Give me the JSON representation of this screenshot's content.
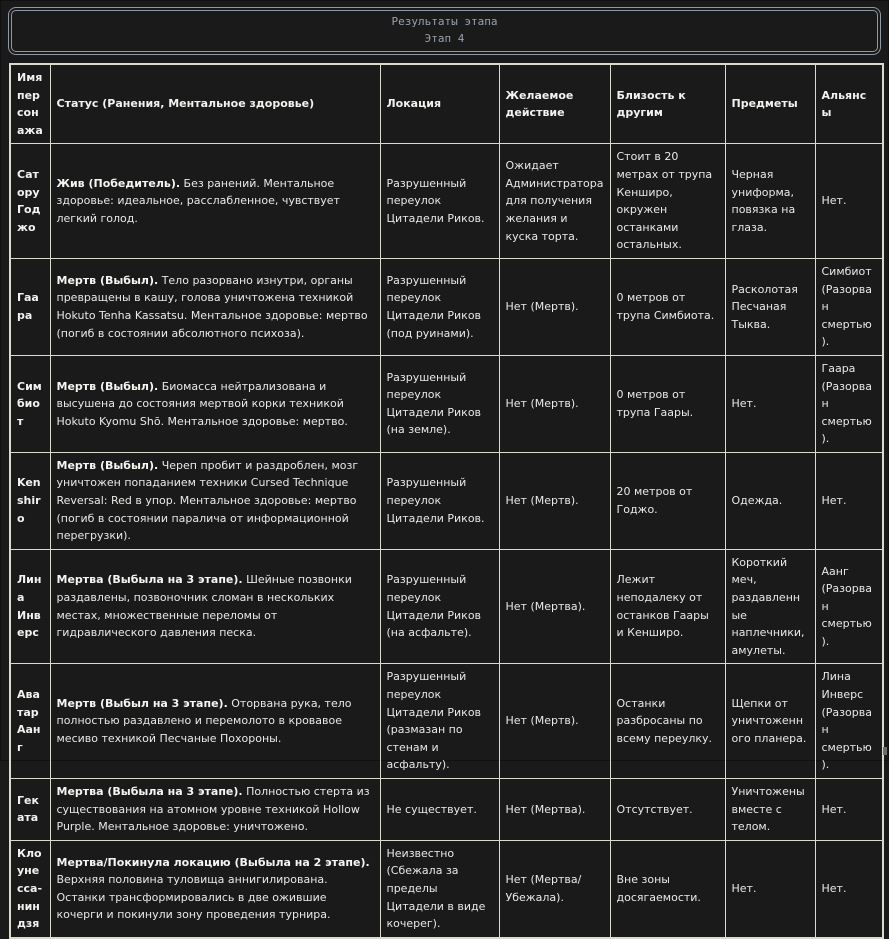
{
  "header": {
    "title_line1": "Результаты этапа",
    "title_line2": "Этап 4"
  },
  "colors": {
    "background": "#1a1a1a",
    "table_border": "#dadacd",
    "title_border": "#8f98a5",
    "title_text": "#98a1ad",
    "cell_text": "#e9e9e6"
  },
  "table": {
    "columns": [
      "Имя персонажа",
      "Статус (Ранения, Ментальное здоровье)",
      "Локация",
      "Желаемое действие",
      "Близость к другим",
      "Предметы",
      "Альянсы"
    ],
    "rows": [
      {
        "name": "Сатору Годжо",
        "status_bold": "Жив (Победитель).",
        "status_rest": " Без ранений. Ментальное здоровье: идеальное, расслабленное, чувствует легкий голод.",
        "location": "Разрушенный переулок Цитадели Риков.",
        "action": "Ожидает Администратора для получения желания и куска торта.",
        "proximity": "Стоит в 20 метрах от трупа Кенширо, окружен останками остальных.",
        "items": "Черная униформа, повязка на глаза.",
        "alliances": "Нет."
      },
      {
        "name": "Гаара",
        "status_bold": "Мертв (Выбыл).",
        "status_rest": " Тело разорвано изнутри, органы превращены в кашу, голова уничтожена техникой Hokuto Tenha Kassatsu. Ментальное здоровье: мертво (погиб в состоянии абсолютного психоза).",
        "location": "Разрушенный переулок Цитадели Риков (под руинами).",
        "action": "Нет (Мертв).",
        "proximity": "0 метров от трупа Симбиота.",
        "items": "Расколотая Песчаная Тыква.",
        "alliances": "Симбиот (Разорван смертью)."
      },
      {
        "name": "Симбиот",
        "status_bold": "Мертв (Выбыл).",
        "status_rest": " Биомасса нейтрализована и высушена до состояния мертвой корки техникой Hokuto Kyomu Shō. Ментальное здоровье: мертво.",
        "location": "Разрушенный переулок Цитадели Риков (на земле).",
        "action": "Нет (Мертв).",
        "proximity": "0 метров от трупа Гаары.",
        "items": "Нет.",
        "alliances": "Гаара (Разорван смертью)."
      },
      {
        "name": "Kenshiro",
        "status_bold": "Мертв (Выбыл).",
        "status_rest": " Череп пробит и раздроблен, мозг уничтожен попаданием техники Cursed Technique Reversal: Red в упор. Ментальное здоровье: мертво (погиб в состоянии паралича от информационной перегрузки).",
        "location": "Разрушенный переулок Цитадели Риков.",
        "action": "Нет (Мертв).",
        "proximity": "20 метров от Годжо.",
        "items": "Одежда.",
        "alliances": "Нет."
      },
      {
        "name": "Лина Инверс",
        "status_bold": "Мертва (Выбыла на 3 этапе).",
        "status_rest": " Шейные позвонки раздавлены, позвоночник сломан в нескольких местах, множественные переломы от гидравлического давления песка.",
        "location": "Разрушенный переулок Цитадели Риков (на асфальте).",
        "action": "Нет (Мертва).",
        "proximity": "Лежит неподалеку от останков Гаары и Кенширо.",
        "items": "Короткий меч, раздавленные наплечники, амулеты.",
        "alliances": "Аанг (Разорван смертью)."
      },
      {
        "name": "Аватар Аанг",
        "status_bold": "Мертв (Выбыл на 3 этапе).",
        "status_rest": " Оторвана рука, тело полностью раздавлено и перемолото в кровавое месиво техникой Песчаные Похороны.",
        "location": "Разрушенный переулок Цитадели Риков (размазан по стенам и асфальту).",
        "action": "Нет (Мертв).",
        "proximity": "Останки разбросаны по всему переулку.",
        "items": "Щепки от уничтоженного планера.",
        "alliances": "Лина Инверс (Разорван смертью)."
      },
      {
        "name": "Геката",
        "status_bold": "Мертва (Выбыла на 3 этапе).",
        "status_rest": " Полностью стерта из существования на атомном уровне техникой Hollow Purple. Ментальное здоровье: уничтожено.",
        "location": "Не существует.",
        "action": "Нет (Мертва).",
        "proximity": "Отсутствует.",
        "items": "Уничтожены вместе с телом.",
        "alliances": "Нет."
      },
      {
        "name": "Клоунесса-ниндзя",
        "status_bold": "Мертва/Покинула локацию (Выбыла на 2 этапе).",
        "status_rest": " Верхняя половина туловища аннигилирована. Останки трансформировались в две ожившие кочерги и покинули зону проведения турнира.",
        "location": "Неизвестно (Сбежала за пределы Цитадели в виде кочерег).",
        "action": "Нет (Мертва/Убежала).",
        "proximity": "Вне зоны досягаемости.",
        "items": "Нет.",
        "alliances": "Нет."
      }
    ]
  }
}
